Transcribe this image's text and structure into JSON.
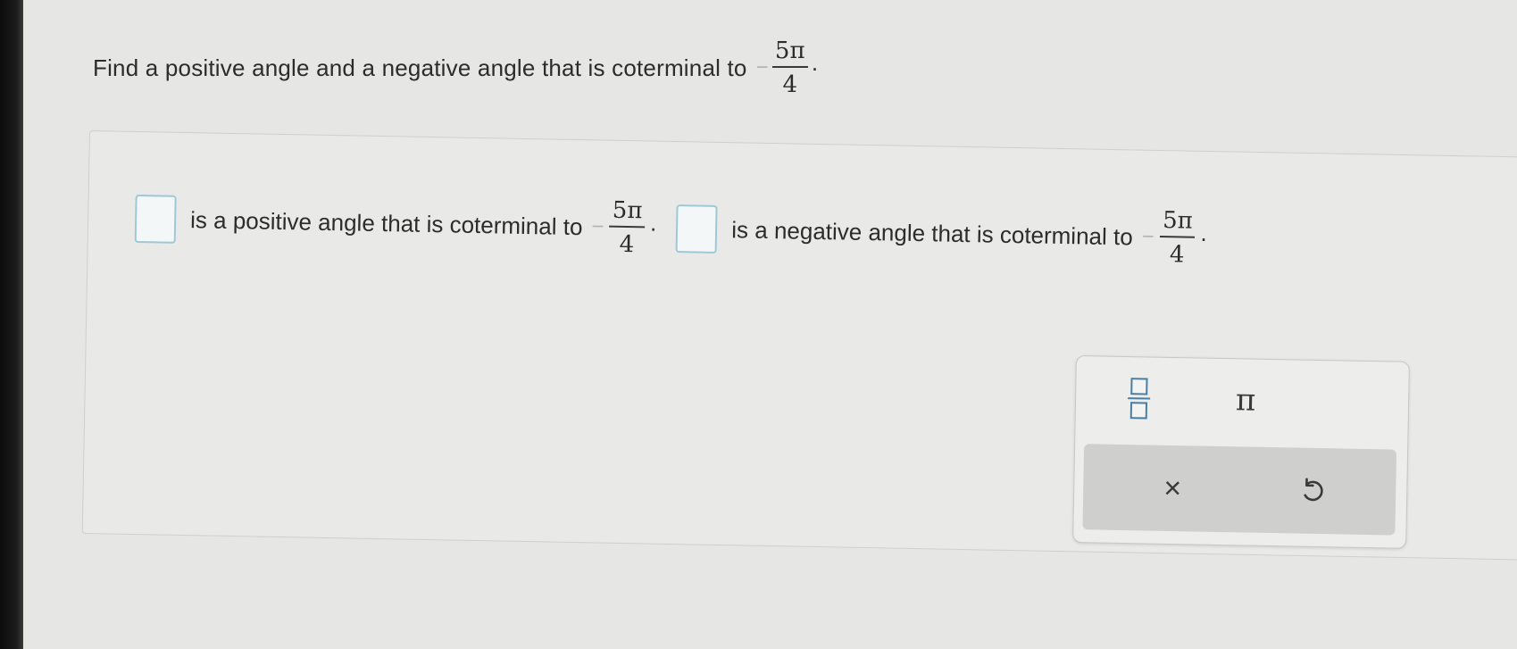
{
  "question": {
    "text": "Find a positive angle and a negative angle that is coterminal to",
    "angle": {
      "sign": "−",
      "numerator": "5π",
      "denominator": "4"
    },
    "period": "."
  },
  "answer": {
    "positive_text": "is a positive angle that is coterminal to",
    "negative_text": "is a negative angle that is coterminal to",
    "angle": {
      "sign": "−",
      "numerator": "5π",
      "denominator": "4"
    },
    "period": ".",
    "positive_value": "",
    "negative_value": ""
  },
  "keypad": {
    "pi_label": "π",
    "clear_label": "×",
    "icons": [
      "fraction-icon",
      "pi-icon",
      "close-icon",
      "undo-icon"
    ]
  }
}
